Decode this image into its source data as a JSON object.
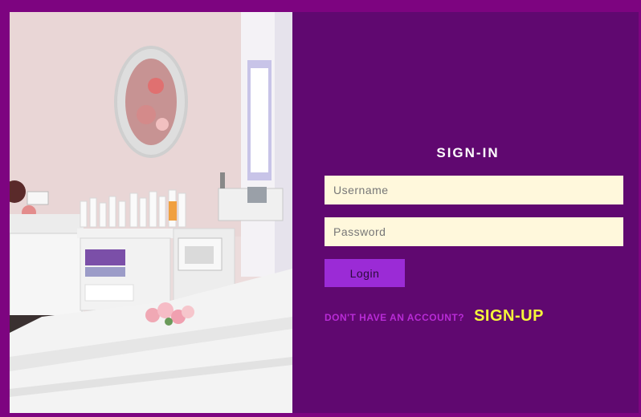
{
  "signin": {
    "title": "SIGN-IN",
    "username_placeholder": "Username",
    "password_placeholder": "Password",
    "login_label": "Login",
    "prompt": "DON'T HAVE AN ACCOUNT?",
    "signup_label": "SIGN-UP"
  },
  "colors": {
    "page_border": "#7d0480",
    "panel_bg": "#600870",
    "field_bg": "#fff8dc",
    "login_bg": "#9b2bd6",
    "prompt": "#b82bd6",
    "signup": "#f5f53a"
  }
}
